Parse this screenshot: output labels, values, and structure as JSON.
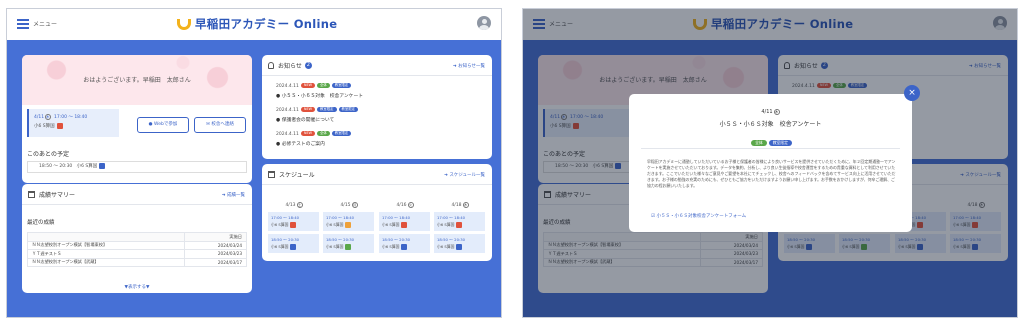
{
  "header": {
    "menu": "メニュー",
    "logo": "早稲田アカデミー Online"
  },
  "greeting": "おはようございます。早稲田　太郎さん",
  "today_slot": {
    "date": "4/11",
    "weekday": "木",
    "time": "17:00 ～ 18:40",
    "class": "小6 S算国"
  },
  "buttons": {
    "web": "Webで参加",
    "school": "校舎へ連絡"
  },
  "upcoming": {
    "heading": "このあとの予定",
    "time": "18:50 ～ 20:30",
    "class": "小6 S算国"
  },
  "notice": {
    "title": "お知らせ",
    "link": "お知らせ一覧",
    "items": [
      {
        "date": "2024.4.11",
        "title": "小５Ｓ・小６Ｓ対象　校舎アンケート",
        "tags": [
          "NEW",
          "全体",
          "教室限定"
        ]
      },
      {
        "date": "2024.4.11",
        "title": "保護者会の開催について",
        "tags": [
          "NEW",
          "教室限定",
          "教室限定"
        ]
      },
      {
        "date": "2024.4.11",
        "title": "必修テストのご案内",
        "tags": [
          "NEW",
          "全体",
          "教室限定"
        ]
      }
    ]
  },
  "schedule": {
    "title": "スケジュール",
    "link": "スケジュール一覧",
    "days": [
      {
        "date": "4/13",
        "weekday": "土"
      },
      {
        "date": "4/15",
        "weekday": "月"
      },
      {
        "date": "4/16",
        "weekday": "火"
      },
      {
        "date": "4/18",
        "weekday": "木"
      }
    ],
    "row1": [
      "17:00 ～ 18:40",
      "17:00 ～ 18:40",
      "17:00 ～ 18:40",
      "17:00 ～ 18:40"
    ],
    "row2": [
      "18:50 ～ 20:30",
      "18:50 ～ 20:30",
      "18:50 ～ 20:30",
      "18:50 ～ 20:30"
    ],
    "class": "小6 S算国"
  },
  "grades": {
    "title": "成績サマリー",
    "link": "成績一覧",
    "recent": "最近の成績",
    "col_date": "実施日",
    "rows": [
      {
        "name": "ＮＮ志望校別オープン模試【智場東校】",
        "date": "2024/03/24"
      },
      {
        "name": "ＹＴ週テストＳ",
        "date": "2024/03/23"
      },
      {
        "name": "ＮＮ志望校別オープン模試【武蔵】",
        "date": "2024/03/17"
      }
    ],
    "more": "▼表示する▼"
  },
  "modal": {
    "date": "4/11",
    "weekday": "木",
    "title": "小５Ｓ・小６Ｓ対象　校舎アンケート",
    "tags": [
      "全体",
      "教室限定"
    ],
    "body": "早稲田アカデミーに通塾していただいているお子様と保護者の皆様により良いサービスを提供させていただくために、年２回定期通塾一でアンケートを実施させていただいております。データを集約、分析し、より良い生徒指導や校舎運営をするための貴重な資料として利用させていただきます。ここでいただいた様々なご意見やご要望を本社にてチェックし、校舎へのフィードバックを含めてサービス向上に活用させていただきます。お子様の勉強の充実のためにも、ぜひともご協力をいただけますようお願い申し上げます。お手数をおかけしますが、何卒ご理解、ご協力の程お願いいたします。",
    "link": "小５Ｓ・小６Ｓ対象校舎アンケートフォーム"
  }
}
